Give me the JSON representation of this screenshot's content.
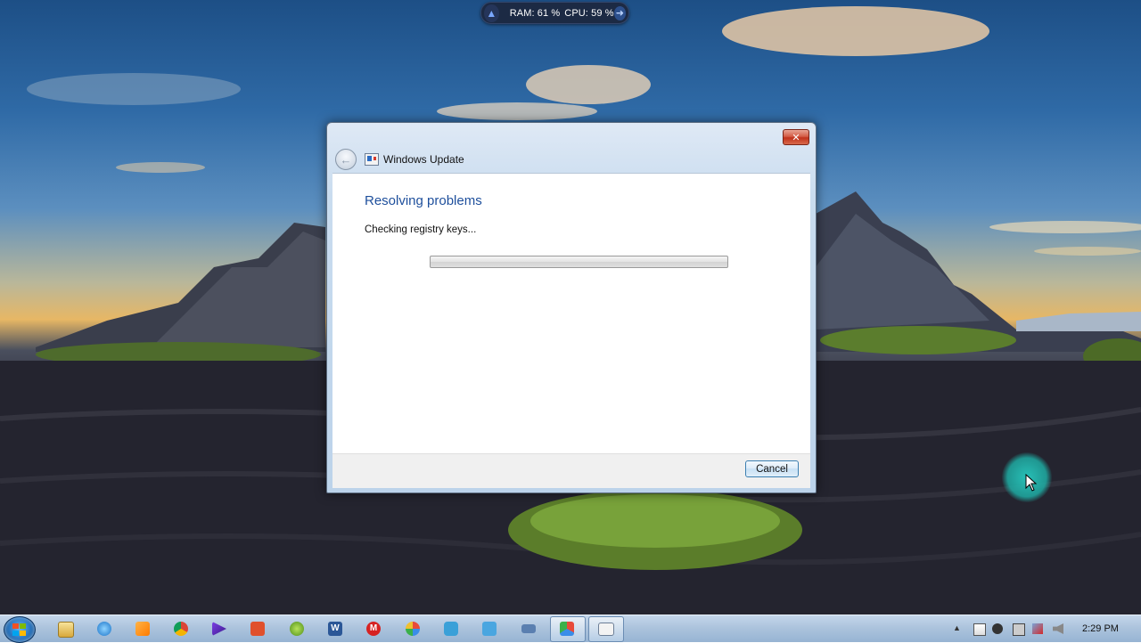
{
  "sysmon": {
    "ram_label": "RAM: 61 %",
    "cpu_label": "CPU: 59 %",
    "icons": [
      "rocket-icon",
      "arrow-right-icon"
    ]
  },
  "window": {
    "title": "Windows Update",
    "close_symbol": "✕",
    "back_symbol": "←",
    "heading": "Resolving problems",
    "status": "Checking registry keys...",
    "progress_fraction": 0,
    "cancel_label": "Cancel"
  },
  "taskbar": {
    "pinned_icons": [
      "file-explorer-icon",
      "internet-explorer-icon",
      "media-player-icon",
      "chrome-icon",
      "video-player-icon",
      "office-app-icon",
      "green-app-icon",
      "word-icon",
      "red-app-icon",
      "pinwheel-icon",
      "snipping-tool-icon",
      "network-tool-icon",
      "keyboard-icon",
      "display-app-icon",
      "windows-update-icon"
    ],
    "tray_icons": [
      "show-hidden-icon",
      "action-center-flag-icon",
      "m-app-icon",
      "power-icon",
      "network-icon",
      "volume-icon"
    ],
    "clock": "2:29 PM"
  },
  "colors": {
    "heading_blue": "#1e4f9c",
    "cursor_halo": "#1eb4aa"
  }
}
